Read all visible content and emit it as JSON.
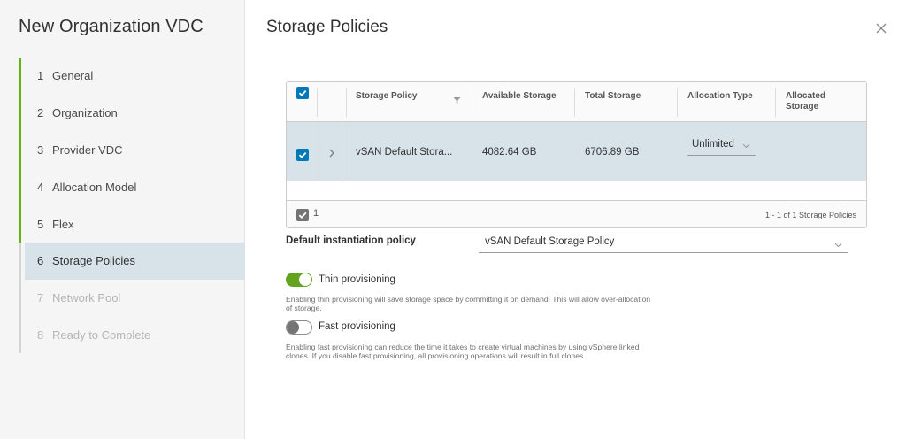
{
  "wizard": {
    "title": "New Organization VDC",
    "steps": [
      {
        "num": "1",
        "label": "General"
      },
      {
        "num": "2",
        "label": "Organization"
      },
      {
        "num": "3",
        "label": "Provider VDC"
      },
      {
        "num": "4",
        "label": "Allocation Model"
      },
      {
        "num": "5",
        "label": "Flex"
      },
      {
        "num": "6",
        "label": "Storage Policies"
      },
      {
        "num": "7",
        "label": "Network Pool"
      },
      {
        "num": "8",
        "label": "Ready to Complete"
      }
    ]
  },
  "page": {
    "title": "Storage Policies",
    "close_icon": "close-icon"
  },
  "grid": {
    "columns": {
      "storage_policy": "Storage Policy",
      "available_storage": "Available Storage",
      "total_storage": "Total Storage",
      "allocation_type": "Allocation Type",
      "allocated_storage": "Allocated Storage"
    },
    "rows": [
      {
        "storage_policy": "vSAN Default Stora...",
        "available_storage": "4082.64 GB",
        "total_storage": "6706.89 GB",
        "allocation_type": "Unlimited",
        "allocated_storage": ""
      }
    ],
    "selected_count": "1",
    "pagination": "1 - 1 of 1 Storage Policies"
  },
  "default_policy": {
    "label": "Default instantiation policy",
    "value": "vSAN Default Storage Policy"
  },
  "thin_provisioning": {
    "label": "Thin provisioning",
    "enabled": true,
    "help": "Enabling thin provisioning will save storage space by committing it on demand. This will allow over-allocation of storage."
  },
  "fast_provisioning": {
    "label": "Fast provisioning",
    "enabled": false,
    "help": "Enabling fast provisioning can reduce the time it takes to create virtual machines by using vSphere linked clones. If you disable fast provisioning, all provisioning operations will result in full clones."
  },
  "colors": {
    "accent": "#0079b8",
    "completed_step": "#60b515",
    "selected_row": "#d8e3e9",
    "toggle_on": "#62a420"
  }
}
